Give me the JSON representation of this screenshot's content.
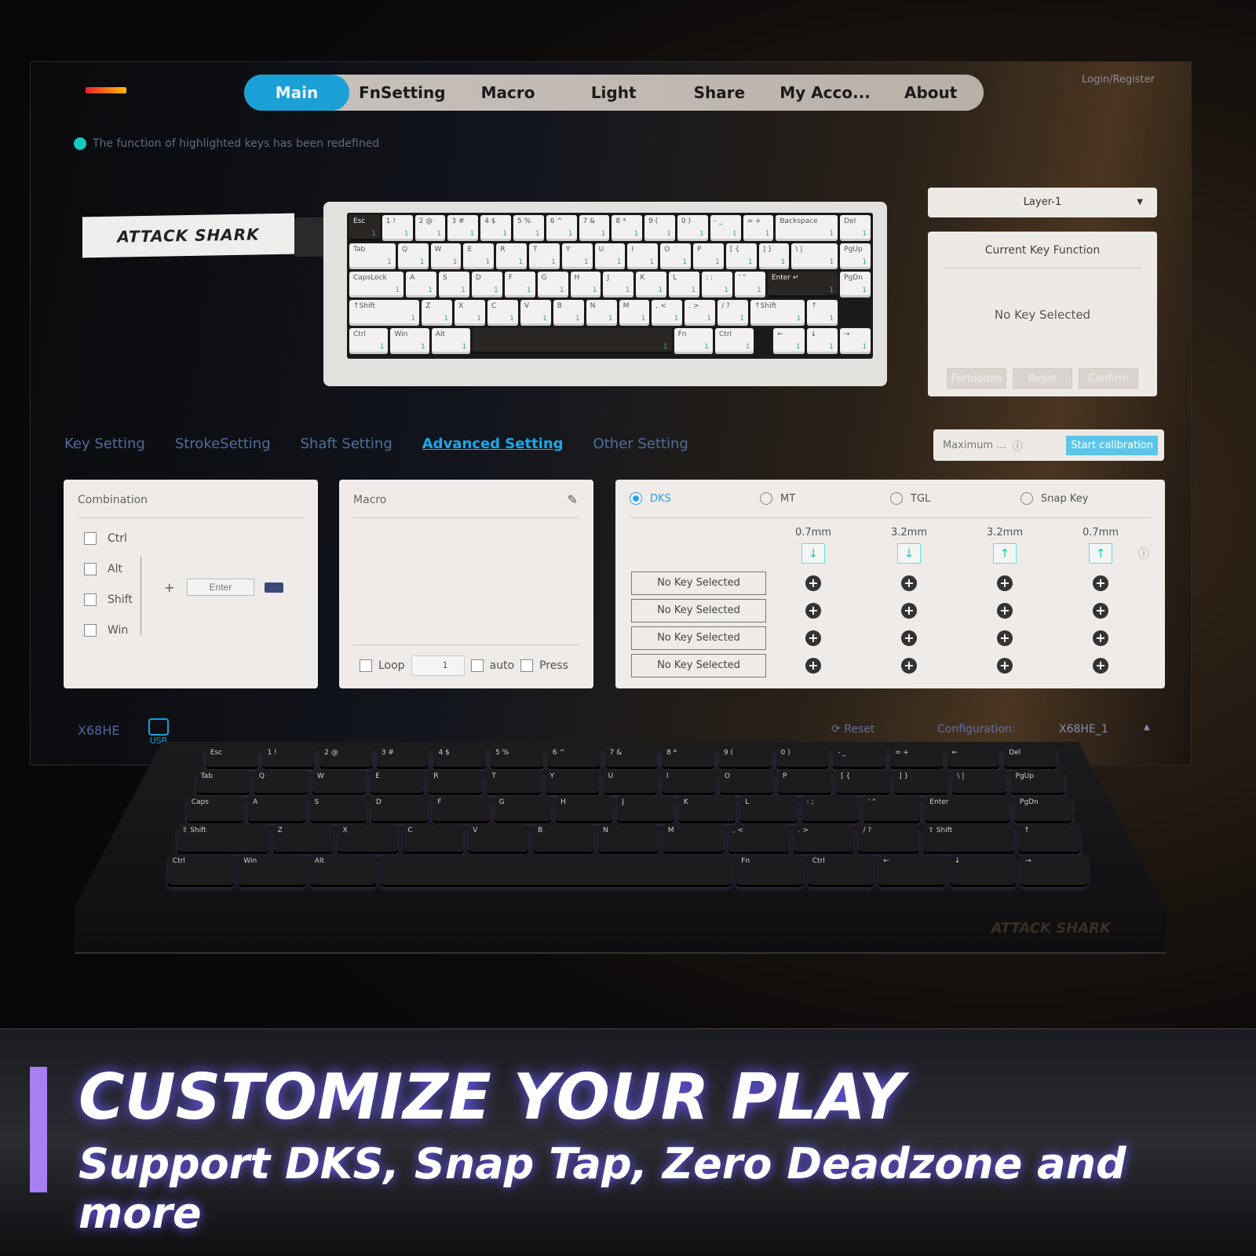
{
  "nav": {
    "tabs": [
      "Main",
      "FnSetting",
      "Macro",
      "Light",
      "Share",
      "My Acco...",
      "About"
    ],
    "active": "Main",
    "login": "Login/Register"
  },
  "notice": "The function of highlighted keys has been redefined",
  "brand": "ATTACK SHARK",
  "keyboard": {
    "layer_badge": "1",
    "rows": [
      [
        [
          "Esc",
          1,
          "dark"
        ],
        [
          "1 !",
          1
        ],
        [
          "2 @",
          1
        ],
        [
          "3 #",
          1
        ],
        [
          "4 $",
          1
        ],
        [
          "5 %",
          1
        ],
        [
          "6 ^",
          1
        ],
        [
          "7 &",
          1
        ],
        [
          "8 *",
          1
        ],
        [
          "9 (",
          1
        ],
        [
          "0 )",
          1
        ],
        [
          "- _",
          1
        ],
        [
          "= +",
          1
        ],
        [
          "Backspace",
          2
        ],
        [
          "Del",
          1
        ]
      ],
      [
        [
          "Tab",
          1.5
        ],
        [
          "Q",
          1
        ],
        [
          "W",
          1
        ],
        [
          "E",
          1
        ],
        [
          "R",
          1
        ],
        [
          "T",
          1
        ],
        [
          "Y",
          1
        ],
        [
          "U",
          1
        ],
        [
          "I",
          1
        ],
        [
          "O",
          1
        ],
        [
          "P",
          1
        ],
        [
          "[ {",
          1
        ],
        [
          "] }",
          1
        ],
        [
          "\\ |",
          1.5
        ],
        [
          "PgUp",
          1
        ]
      ],
      [
        [
          "CapsLock",
          1.75
        ],
        [
          "A",
          1
        ],
        [
          "S",
          1
        ],
        [
          "D",
          1
        ],
        [
          "F",
          1
        ],
        [
          "G",
          1
        ],
        [
          "H",
          1
        ],
        [
          "J",
          1
        ],
        [
          "K",
          1
        ],
        [
          "L",
          1
        ],
        [
          "; :",
          1
        ],
        [
          "' \"",
          1
        ],
        [
          "Enter ↵",
          2.25,
          "dark"
        ],
        [
          "PgDn",
          1
        ]
      ],
      [
        [
          "↑Shift",
          2.25
        ],
        [
          "Z",
          1
        ],
        [
          "X",
          1
        ],
        [
          "C",
          1
        ],
        [
          "V",
          1
        ],
        [
          "B",
          1
        ],
        [
          "N",
          1
        ],
        [
          "M",
          1
        ],
        [
          ", <",
          1
        ],
        [
          ". >",
          1
        ],
        [
          "/ ?",
          1
        ],
        [
          "↑Shift",
          1.75
        ],
        [
          "↑",
          1
        ],
        [
          "",
          1,
          "empty"
        ]
      ],
      [
        [
          "Ctrl",
          1.25
        ],
        [
          "Win",
          1.25
        ],
        [
          "Alt",
          1.25
        ],
        [
          "",
          6.25,
          "dark"
        ],
        [
          "Fn",
          1.25
        ],
        [
          "Ctrl",
          1.25
        ],
        [
          "",
          0.5,
          "empty"
        ],
        [
          "←",
          1
        ],
        [
          "↓",
          1
        ],
        [
          "→",
          1
        ]
      ]
    ]
  },
  "layer_select": "Layer-1",
  "current_key": {
    "title": "Current Key Function",
    "value": "No Key Selected",
    "buttons": [
      "Forbidden",
      "Reset",
      "Confirm"
    ]
  },
  "subtabs": {
    "items": [
      "Key Setting",
      "StrokeSetting",
      "Shaft Setting",
      "Advanced Setting",
      "Other Setting"
    ],
    "active": "Advanced Setting"
  },
  "calibration": {
    "label": "Maximum ...",
    "button": "Start calibration"
  },
  "combination": {
    "title": "Combination",
    "modifiers": [
      "Ctrl",
      "Alt",
      "Shift",
      "Win"
    ],
    "key_placeholder": "Enter"
  },
  "macro": {
    "title": "Macro",
    "loop_label": "Loop",
    "loop_count": "1",
    "auto_label": "auto",
    "press_label": "Press"
  },
  "advanced": {
    "modes": [
      "DKS",
      "MT",
      "TGL",
      "Snap Key"
    ],
    "selected": "DKS",
    "columns": [
      {
        "travel": "0.7mm",
        "dir": "↓"
      },
      {
        "travel": "3.2mm",
        "dir": "↓"
      },
      {
        "travel": "3.2mm",
        "dir": "↑"
      },
      {
        "travel": "0.7mm",
        "dir": "↑"
      }
    ],
    "slots": [
      "No Key Selected",
      "No Key Selected",
      "No Key Selected",
      "No Key Selected"
    ]
  },
  "statusbar": {
    "device": "X68HE",
    "connection": "USB",
    "reset": "Reset",
    "config_label": "Configuration:",
    "config_value": "X68HE_1"
  },
  "physical_rows": [
    [
      "Esc",
      "1 !",
      "2 @",
      "3 #",
      "4 $",
      "5 %",
      "6 ^",
      "7 &",
      "8 *",
      "9 (",
      "0 )",
      "- _",
      "= +",
      "←",
      "Del"
    ],
    [
      "Tab",
      "Q",
      "W",
      "E",
      "R",
      "T",
      "Y",
      "U",
      "I",
      "O",
      "P",
      "[ {",
      "] }",
      "\\ |",
      "PgUp"
    ],
    [
      "Caps",
      "A",
      "S",
      "D",
      "F",
      "G",
      "H",
      "J",
      "K",
      "L",
      ": ;",
      "' \"",
      "Enter",
      "PgDn"
    ],
    [
      "⇧ Shift",
      "Z",
      "X",
      "C",
      "V",
      "B",
      "N",
      "M",
      ", <",
      ". >",
      "/ ?",
      "⇧ Shift",
      "↑"
    ],
    [
      "Ctrl",
      "Win",
      "Alt",
      "",
      "Fn",
      "Ctrl",
      "←",
      "↓",
      "→"
    ]
  ],
  "headline": "CUSTOMIZE YOUR PLAY",
  "subheadline": "Support DKS, Snap Tap, Zero Deadzone and more",
  "colors": {
    "accent": "#1ba0d6",
    "highlight": "#16c9c0",
    "banner_bar": "#a77ff0"
  }
}
